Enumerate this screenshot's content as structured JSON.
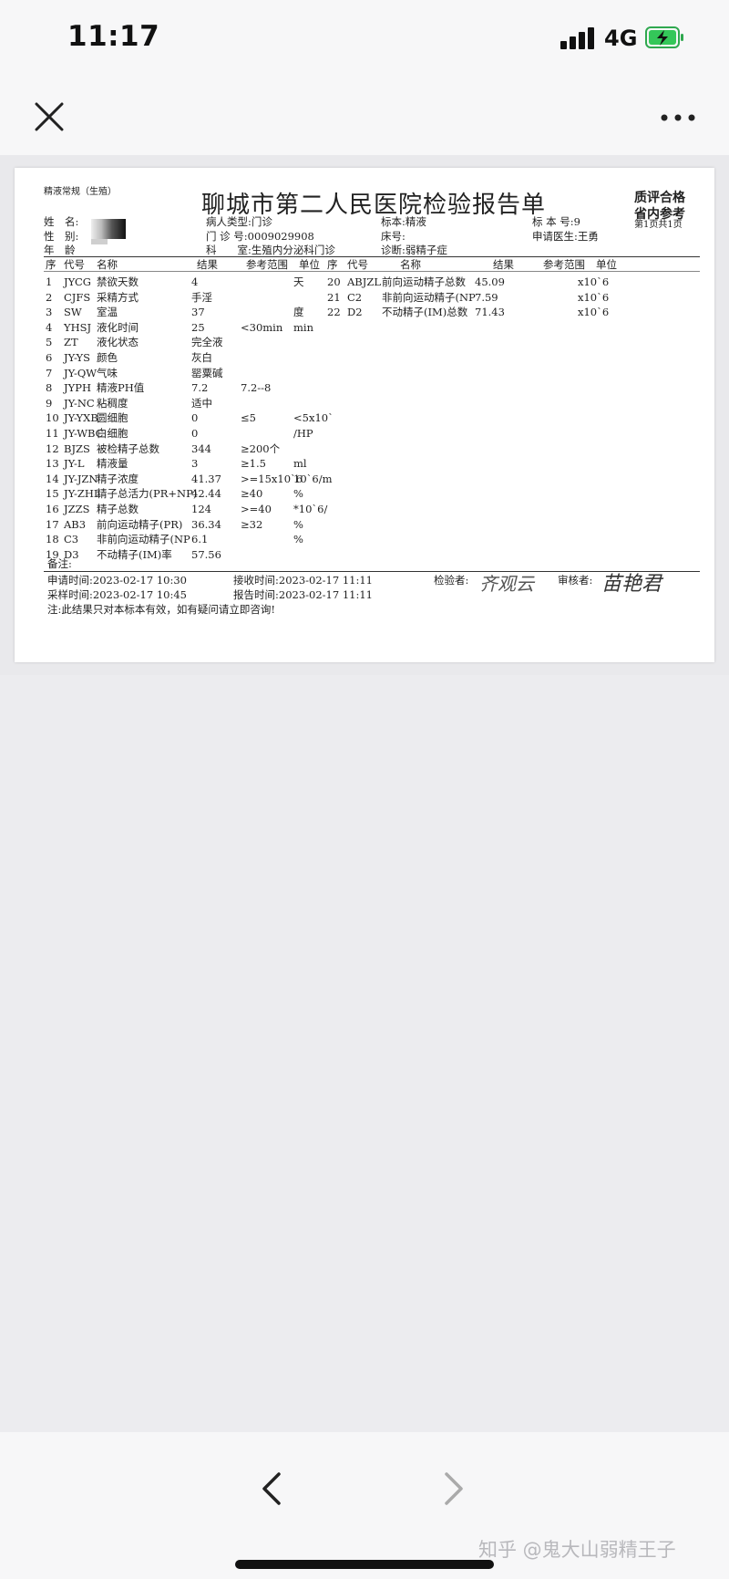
{
  "status_bar": {
    "time": "11:17",
    "network": "4G"
  },
  "report": {
    "category": "精液常规（生殖）",
    "hospital_title": "聊城市第二人民医院检验报告单",
    "quality_line1": "质评合格",
    "quality_line2": "省内参考",
    "page_info": "第1页共1页",
    "header": {
      "name_label": "姓　名:",
      "gender_label": "性　别:",
      "age_label": "年　龄",
      "patient_type": "病人类型:门诊",
      "clinic_no": "门 诊 号:0009029908",
      "department": "科　　室:生殖内分泌科门诊",
      "specimen": "标本:精液",
      "bed": "床号:",
      "diagnosis": "诊断:弱精子症",
      "specimen_no": "标 本 号:9",
      "doctor": "申请医生:王勇"
    },
    "columns_left": [
      "序",
      "代号",
      "名称",
      "结果",
      "参考范围",
      "单位"
    ],
    "columns_right": [
      "序",
      "代号",
      "名称",
      "结果",
      "参考范围",
      "单位"
    ],
    "rows_left": [
      {
        "no": "1",
        "code": "JYCG",
        "name": "禁欲天数",
        "result": "4",
        "ref": "",
        "unit": "天"
      },
      {
        "no": "2",
        "code": "CJFS",
        "name": "采精方式",
        "result": "手淫",
        "ref": "",
        "unit": ""
      },
      {
        "no": "3",
        "code": "SW",
        "name": "室温",
        "result": "37",
        "ref": "",
        "unit": "度"
      },
      {
        "no": "4",
        "code": "YHSJ",
        "name": "液化时间",
        "result": "25",
        "ref": "<30min",
        "unit": "min"
      },
      {
        "no": "5",
        "code": "ZT",
        "name": "液化状态",
        "result": "完全液",
        "ref": "",
        "unit": ""
      },
      {
        "no": "6",
        "code": "JY-YS",
        "name": "颜色",
        "result": "灰白",
        "ref": "",
        "unit": ""
      },
      {
        "no": "7",
        "code": "JY-QW",
        "name": "气味",
        "result": "罂粟碱",
        "ref": "",
        "unit": ""
      },
      {
        "no": "8",
        "code": "JYPH",
        "name": "精液PH值",
        "result": "7.2",
        "ref": "7.2--8",
        "unit": ""
      },
      {
        "no": "9",
        "code": "JY-NC",
        "name": "粘稠度",
        "result": "适中",
        "ref": "",
        "unit": ""
      },
      {
        "no": "10",
        "code": "JY-YXB",
        "name": "圆细胞",
        "result": "0",
        "ref": "≤5",
        "unit": "<5x10`"
      },
      {
        "no": "11",
        "code": "JY-WBC",
        "name": "白细胞",
        "result": "0",
        "ref": "",
        "unit": "/HP"
      },
      {
        "no": "12",
        "code": "BJZS",
        "name": "被检精子总数",
        "result": "344",
        "ref": "≥200个",
        "unit": ""
      },
      {
        "no": "13",
        "code": "JY-L",
        "name": "精液量",
        "result": "3",
        "ref": "≥1.5",
        "unit": "ml"
      },
      {
        "no": "14",
        "code": "JY-JZN",
        "name": "精子浓度",
        "result": "41.37",
        "ref": ">=15x10`6",
        "unit": "10`6/m"
      },
      {
        "no": "15",
        "code": "JY-ZHL",
        "name": "精子总活力(PR+NP)",
        "result": "42.44",
        "ref": "≥40",
        "unit": "%"
      },
      {
        "no": "16",
        "code": "JZZS",
        "name": "精子总数",
        "result": "124",
        "ref": ">=40",
        "unit": "*10`6/"
      },
      {
        "no": "17",
        "code": "AB3",
        "name": "前向运动精子(PR)",
        "result": "36.34",
        "ref": "≥32",
        "unit": "%"
      },
      {
        "no": "18",
        "code": "C3",
        "name": "非前向运动精子(NP",
        "result": "6.1",
        "ref": "",
        "unit": "%"
      },
      {
        "no": "19",
        "code": "D3",
        "name": "不动精子(IM)率",
        "result": "57.56",
        "ref": "",
        "unit": ""
      }
    ],
    "rows_right": [
      {
        "no": "20",
        "code": "ABJZL",
        "name": "前向运动精子总数",
        "result": "45.09",
        "ref": "",
        "unit": "x10`6"
      },
      {
        "no": "21",
        "code": "C2",
        "name": "非前向运动精子(NP",
        "result": "7.59",
        "ref": "",
        "unit": "x10`6"
      },
      {
        "no": "22",
        "code": "D2",
        "name": "不动精子(IM)总数",
        "result": "71.43",
        "ref": "",
        "unit": "x10`6"
      }
    ],
    "remarks_label": "备注:",
    "request_time": "申请时间:2023-02-17 10:30",
    "receive_time": "接收时间:2023-02-17 11:11",
    "collect_time": "采样时间:2023-02-17 10:45",
    "report_time": "报告时间:2023-02-17 11:11",
    "examiner_label": "检验者:",
    "reviewer_label": "审核者:",
    "examiner_sig": "齐观云",
    "reviewer_sig": "苗艳君",
    "note": "注:此结果只对本标本有效，如有疑问请立即咨询!"
  },
  "watermark": "知乎 @鬼大山弱精王子"
}
